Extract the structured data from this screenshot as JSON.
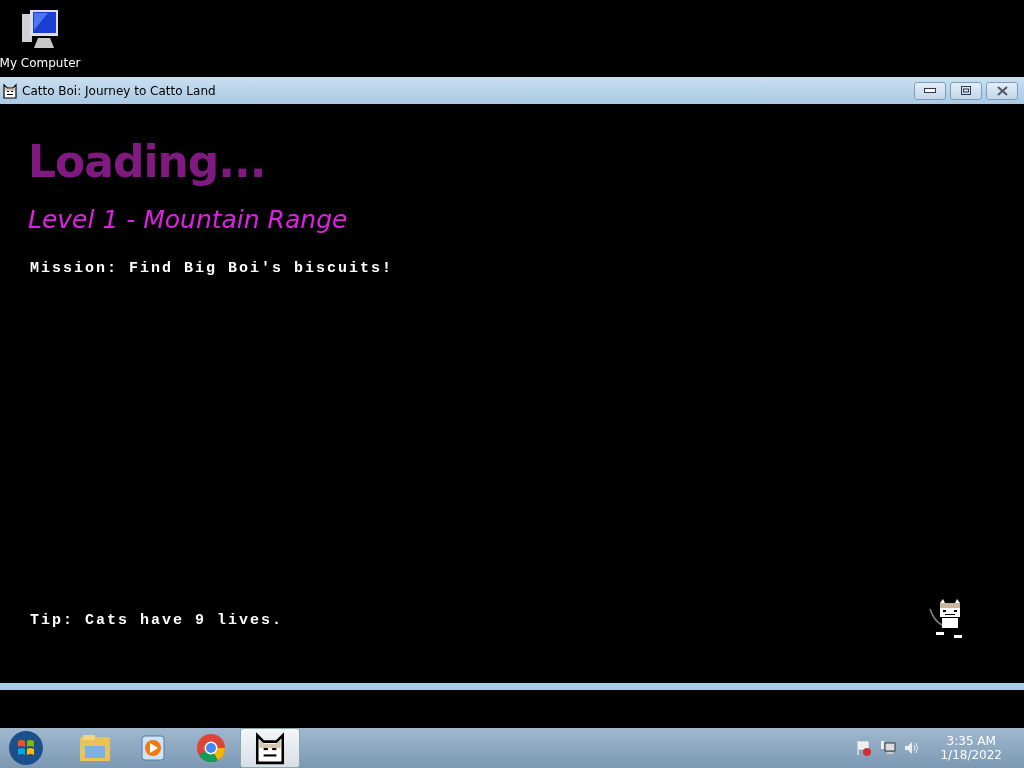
{
  "desktop_icons": [
    {
      "label": "My Computer"
    }
  ],
  "window": {
    "title": "Catto Boi: Journey to Catto Land"
  },
  "game": {
    "heading": "Loading...",
    "level": "Level 1 - Mountain Range",
    "mission": "Mission: Find Big Boi's biscuits!",
    "tip": "Tip: Cats have 9 lives."
  },
  "taskbar": {
    "apps": [
      {
        "kind": "folder",
        "selected": false
      },
      {
        "kind": "media",
        "selected": false
      },
      {
        "kind": "browser",
        "selected": false
      },
      {
        "kind": "cat",
        "selected": true
      }
    ],
    "clock": {
      "time": "3:35 AM",
      "date": "1/18/2022"
    }
  }
}
